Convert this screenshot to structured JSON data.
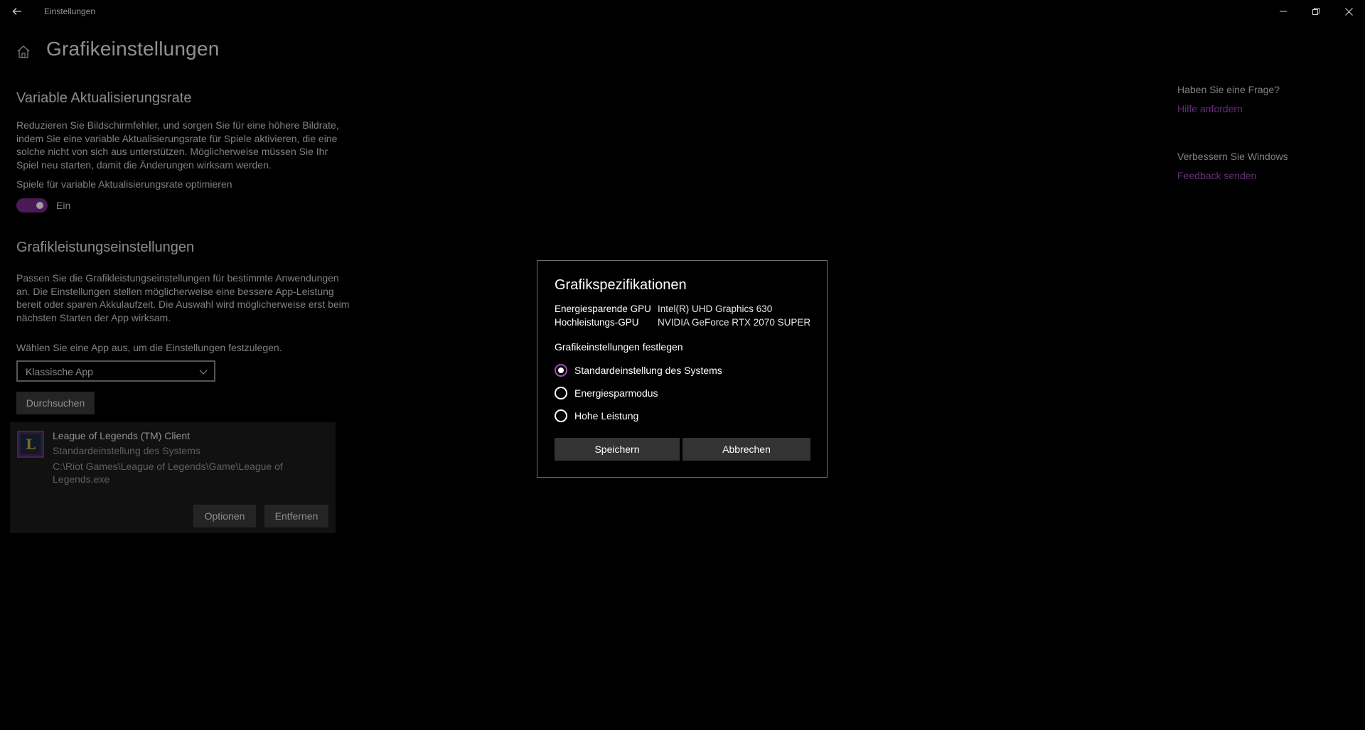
{
  "window": {
    "title": "Einstellungen",
    "back_icon": "arrow-left-icon",
    "minimize_icon": "minimize-icon",
    "restore_icon": "restore-icon",
    "close_icon": "close-icon"
  },
  "page": {
    "title": "Grafikeinstellungen",
    "home_icon": "home-icon"
  },
  "vrr": {
    "heading": "Variable Aktualisierungsrate",
    "description": "Reduzieren Sie Bildschirmfehler, und sorgen Sie für eine höhere Bildrate, indem Sie eine variable Aktualisierungsrate für Spiele aktivieren, die eine solche nicht von sich aus unterstützen. Möglicherweise müssen Sie Ihr Spiel neu starten, damit die Änderungen wirksam werden.",
    "toggle_label": "Spiele für variable Aktualisierungsrate optimieren",
    "toggle_state": "Ein",
    "toggle_on": true
  },
  "perf": {
    "heading": "Grafikleistungseinstellungen",
    "description": "Passen Sie die Grafikleistungseinstellungen für bestimmte Anwendungen an. Die Einstellungen stellen möglicherweise eine bessere App-Leistung bereit oder sparen Akkulaufzeit. Die Auswahl wird möglicherweise erst beim nächsten Starten der App wirksam.",
    "select_prompt": "Wählen Sie eine App aus, um die Einstellungen festzulegen.",
    "select_value": "Klassische App",
    "browse_label": "Durchsuchen"
  },
  "app_entry": {
    "name": "League of Legends (TM) Client",
    "setting": "Standardeinstellung des Systems",
    "path": "C:\\Riot Games\\League of Legends\\Game\\League of Legends.exe",
    "options_label": "Optionen",
    "remove_label": "Entfernen",
    "icon": "league-of-legends-icon"
  },
  "sidebar": {
    "question_heading": "Haben Sie eine Frage?",
    "help_link": "Hilfe anfordern",
    "improve_heading": "Verbessern Sie Windows",
    "feedback_link": "Feedback senden"
  },
  "dialog": {
    "title": "Grafikspezifikationen",
    "specs": [
      {
        "label": "Energiesparende GPU",
        "value": "Intel(R) UHD Graphics 630"
      },
      {
        "label": "Hochleistungs-GPU",
        "value": "NVIDIA GeForce RTX 2070 SUPER"
      }
    ],
    "subheading": "Grafikeinstellungen festlegen",
    "options": [
      {
        "label": "Standardeinstellung des Systems",
        "selected": true
      },
      {
        "label": "Energiesparmodus",
        "selected": false
      },
      {
        "label": "Hohe Leistung",
        "selected": false
      }
    ],
    "save_label": "Speichern",
    "cancel_label": "Abbrechen"
  },
  "colors": {
    "accent": "#a24fbe",
    "toggle_on": "#7a2a8c",
    "background": "#000000"
  }
}
